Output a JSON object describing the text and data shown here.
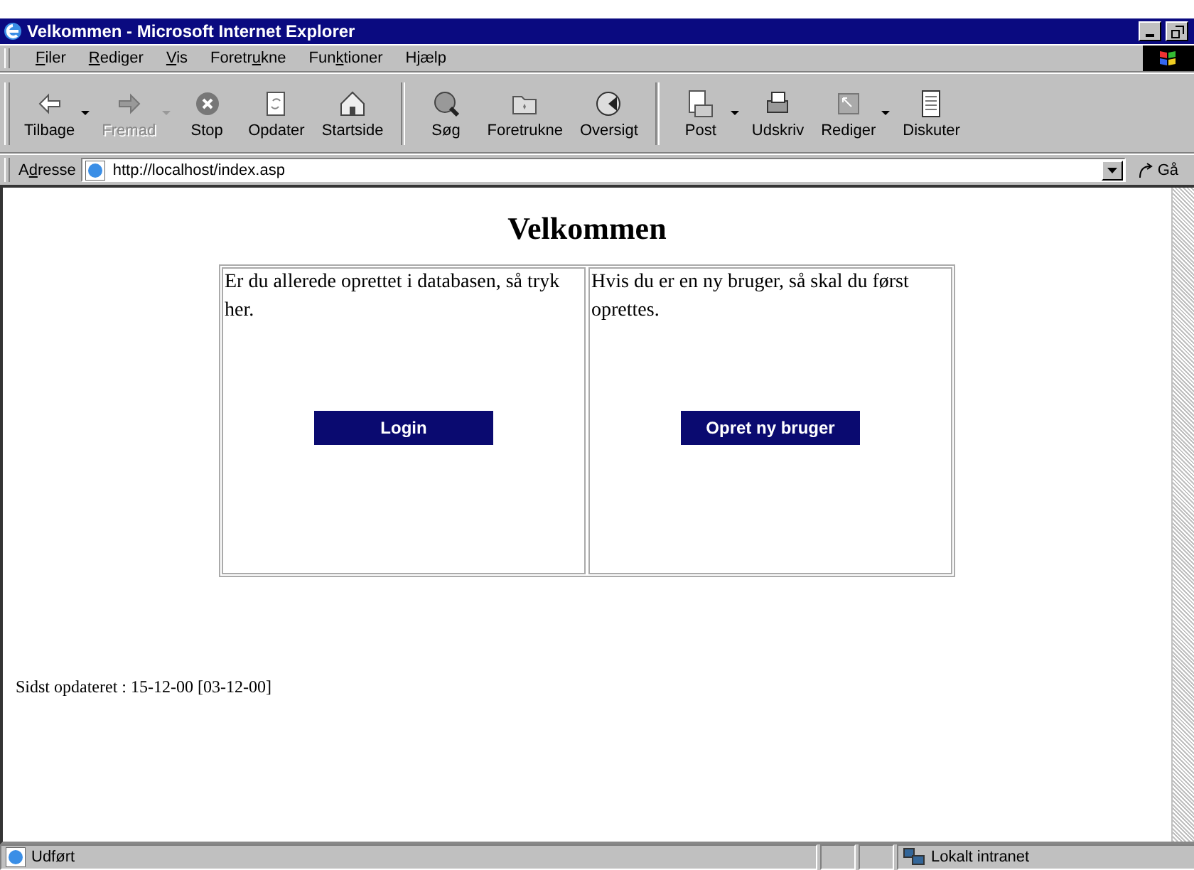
{
  "window": {
    "title": "Velkommen - Microsoft Internet Explorer"
  },
  "menu": [
    {
      "key": "F",
      "post": "iler"
    },
    {
      "key": "R",
      "post": "ediger"
    },
    {
      "key": "V",
      "post": "is"
    },
    {
      "pre": "Foretr",
      "key": "u",
      "post": "kne"
    },
    {
      "pre": "Fun",
      "key": "k",
      "post": "tioner"
    },
    {
      "pre": "H",
      "key": "j",
      "post": "ælp"
    }
  ],
  "toolbar": [
    {
      "label": "Tilbage",
      "kind": "back",
      "disabled": false,
      "dropdown": true
    },
    {
      "label": "Fremad",
      "kind": "forward",
      "disabled": true,
      "dropdown": true
    },
    {
      "label": "Stop",
      "kind": "stop",
      "disabled": false,
      "dropdown": false
    },
    {
      "label": "Opdater",
      "kind": "refresh",
      "disabled": false,
      "dropdown": false
    },
    {
      "label": "Startside",
      "kind": "home",
      "disabled": false,
      "dropdown": false
    },
    {
      "kind": "separator"
    },
    {
      "label": "Søg",
      "kind": "search",
      "disabled": false,
      "dropdown": false
    },
    {
      "label": "Foretrukne",
      "kind": "favorites",
      "disabled": false,
      "dropdown": false
    },
    {
      "label": "Oversigt",
      "kind": "history",
      "disabled": false,
      "dropdown": false
    },
    {
      "kind": "separator"
    },
    {
      "label": "Post",
      "kind": "mail",
      "disabled": false,
      "dropdown": true
    },
    {
      "label": "Udskriv",
      "kind": "print",
      "disabled": false,
      "dropdown": false
    },
    {
      "label": "Rediger",
      "kind": "edit",
      "disabled": false,
      "dropdown": true
    },
    {
      "label": "Diskuter",
      "kind": "discuss",
      "disabled": false,
      "dropdown": false
    }
  ],
  "address": {
    "label_pre": "A",
    "label_key": "d",
    "label_post": "resse",
    "value": "http://localhost/index.asp",
    "go": "Gå"
  },
  "page": {
    "heading": "Velkommen",
    "cells": [
      {
        "text": "Er du allerede oprettet i databasen, så tryk her.",
        "button": "Login"
      },
      {
        "text": "Hvis du er en ny bruger, så skal du først oprettes.",
        "button": "Opret ny bruger"
      }
    ],
    "footer": "Sidst opdateret : 15-12-00 [03-12-00]"
  },
  "status_bar": {
    "text": "Udført",
    "zone": "Lokalt intranet"
  }
}
